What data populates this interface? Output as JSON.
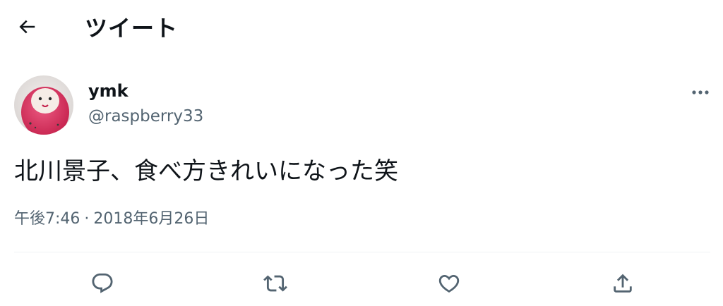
{
  "header": {
    "title": "ツイート",
    "back_icon": "arrow-left-icon"
  },
  "tweet": {
    "author": {
      "display_name": "ymk",
      "username": "@raspberry33",
      "avatar_icon": "avatar-daruma-image"
    },
    "text": "北川景子、食べ方きれいになった笑",
    "time": "午後7:46",
    "separator": "·",
    "date": "2018年6月26日",
    "more_icon": "more-dots-icon"
  },
  "actions": [
    {
      "name": "reply",
      "icon": "reply-icon"
    },
    {
      "name": "retweet",
      "icon": "retweet-icon"
    },
    {
      "name": "like",
      "icon": "heart-icon"
    },
    {
      "name": "share",
      "icon": "share-icon"
    }
  ],
  "colors": {
    "text": "#0f1419",
    "secondary_text": "#536471",
    "divider": "#eff3f4",
    "avatar_red": "#d8315b"
  }
}
